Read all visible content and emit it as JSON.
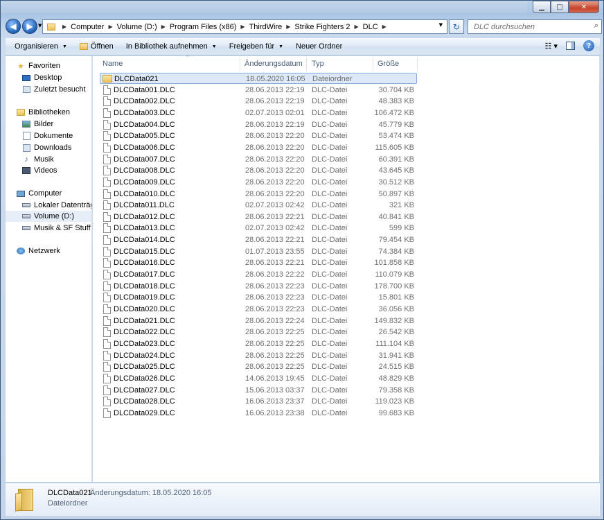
{
  "address": {
    "crumbs": [
      "Computer",
      "Volume (D:)",
      "Program Files (x86)",
      "ThirdWire",
      "Strike Fighters 2",
      "DLC"
    ],
    "search_placeholder": "DLC durchsuchen"
  },
  "toolbar": {
    "organize": "Organisieren",
    "open": "Öffnen",
    "library": "In Bibliothek aufnehmen",
    "share": "Freigeben für",
    "new_folder": "Neuer Ordner"
  },
  "nav": {
    "favorites": "Favoriten",
    "desktop": "Desktop",
    "recent": "Zuletzt besucht",
    "libraries": "Bibliotheken",
    "pictures": "Bilder",
    "documents": "Dokumente",
    "downloads": "Downloads",
    "music": "Musik",
    "videos": "Videos",
    "computer": "Computer",
    "local_disk": "Lokaler Datenträger",
    "volume_d": "Volume (D:)",
    "music_sf": "Musik & SF Stuff (F:)",
    "network": "Netzwerk"
  },
  "columns": {
    "name": "Name",
    "date": "Änderungsdatum",
    "type": "Typ",
    "size": "Größe"
  },
  "files": [
    {
      "name": "DLCData021",
      "date": "18.05.2020 16:05",
      "type": "Dateiordner",
      "size": "",
      "folder": true,
      "selected": true
    },
    {
      "name": "DLCData001.DLC",
      "date": "28.06.2013 22:19",
      "type": "DLC-Datei",
      "size": "30.704 KB"
    },
    {
      "name": "DLCData002.DLC",
      "date": "28.06.2013 22:19",
      "type": "DLC-Datei",
      "size": "48.383 KB"
    },
    {
      "name": "DLCData003.DLC",
      "date": "02.07.2013 02:01",
      "type": "DLC-Datei",
      "size": "106.472 KB"
    },
    {
      "name": "DLCData004.DLC",
      "date": "28.06.2013 22:19",
      "type": "DLC-Datei",
      "size": "45.779 KB"
    },
    {
      "name": "DLCData005.DLC",
      "date": "28.06.2013 22:20",
      "type": "DLC-Datei",
      "size": "53.474 KB"
    },
    {
      "name": "DLCData006.DLC",
      "date": "28.06.2013 22:20",
      "type": "DLC-Datei",
      "size": "115.605 KB"
    },
    {
      "name": "DLCData007.DLC",
      "date": "28.06.2013 22:20",
      "type": "DLC-Datei",
      "size": "60.391 KB"
    },
    {
      "name": "DLCData008.DLC",
      "date": "28.06.2013 22:20",
      "type": "DLC-Datei",
      "size": "43.645 KB"
    },
    {
      "name": "DLCData009.DLC",
      "date": "28.06.2013 22:20",
      "type": "DLC-Datei",
      "size": "30.512 KB"
    },
    {
      "name": "DLCData010.DLC",
      "date": "28.06.2013 22:20",
      "type": "DLC-Datei",
      "size": "50.897 KB"
    },
    {
      "name": "DLCData011.DLC",
      "date": "02.07.2013 02:42",
      "type": "DLC-Datei",
      "size": "321 KB"
    },
    {
      "name": "DLCData012.DLC",
      "date": "28.06.2013 22:21",
      "type": "DLC-Datei",
      "size": "40.841 KB"
    },
    {
      "name": "DLCData013.DLC",
      "date": "02.07.2013 02:42",
      "type": "DLC-Datei",
      "size": "599 KB"
    },
    {
      "name": "DLCData014.DLC",
      "date": "28.06.2013 22:21",
      "type": "DLC-Datei",
      "size": "79.454 KB"
    },
    {
      "name": "DLCData015.DLC",
      "date": "01.07.2013 23:55",
      "type": "DLC-Datei",
      "size": "74.384 KB"
    },
    {
      "name": "DLCData016.DLC",
      "date": "28.06.2013 22:21",
      "type": "DLC-Datei",
      "size": "101.858 KB"
    },
    {
      "name": "DLCData017.DLC",
      "date": "28.06.2013 22:22",
      "type": "DLC-Datei",
      "size": "110.079 KB"
    },
    {
      "name": "DLCData018.DLC",
      "date": "28.06.2013 22:23",
      "type": "DLC-Datei",
      "size": "178.700 KB"
    },
    {
      "name": "DLCData019.DLC",
      "date": "28.06.2013 22:23",
      "type": "DLC-Datei",
      "size": "15.801 KB"
    },
    {
      "name": "DLCData020.DLC",
      "date": "28.06.2013 22:23",
      "type": "DLC-Datei",
      "size": "36.056 KB"
    },
    {
      "name": "DLCData021.DLC",
      "date": "28.06.2013 22:24",
      "type": "DLC-Datei",
      "size": "149.832 KB"
    },
    {
      "name": "DLCData022.DLC",
      "date": "28.06.2013 22:25",
      "type": "DLC-Datei",
      "size": "26.542 KB"
    },
    {
      "name": "DLCData023.DLC",
      "date": "28.06.2013 22:25",
      "type": "DLC-Datei",
      "size": "111.104 KB"
    },
    {
      "name": "DLCData024.DLC",
      "date": "28.06.2013 22:25",
      "type": "DLC-Datei",
      "size": "31.941 KB"
    },
    {
      "name": "DLCData025.DLC",
      "date": "28.06.2013 22:25",
      "type": "DLC-Datei",
      "size": "24.515 KB"
    },
    {
      "name": "DLCData026.DLC",
      "date": "14.06.2013 19:45",
      "type": "DLC-Datei",
      "size": "48.829 KB"
    },
    {
      "name": "DLCData027.DLC",
      "date": "15.06.2013 03:37",
      "type": "DLC-Datei",
      "size": "79.358 KB"
    },
    {
      "name": "DLCData028.DLC",
      "date": "16.06.2013 23:37",
      "type": "DLC-Datei",
      "size": "119.023 KB"
    },
    {
      "name": "DLCData029.DLC",
      "date": "16.06.2013 23:38",
      "type": "DLC-Datei",
      "size": "99.683 KB"
    }
  ],
  "details": {
    "name": "DLCData021",
    "meta": "Änderungsdatum: 18.05.2020 16:05",
    "type": "Dateiordner"
  }
}
